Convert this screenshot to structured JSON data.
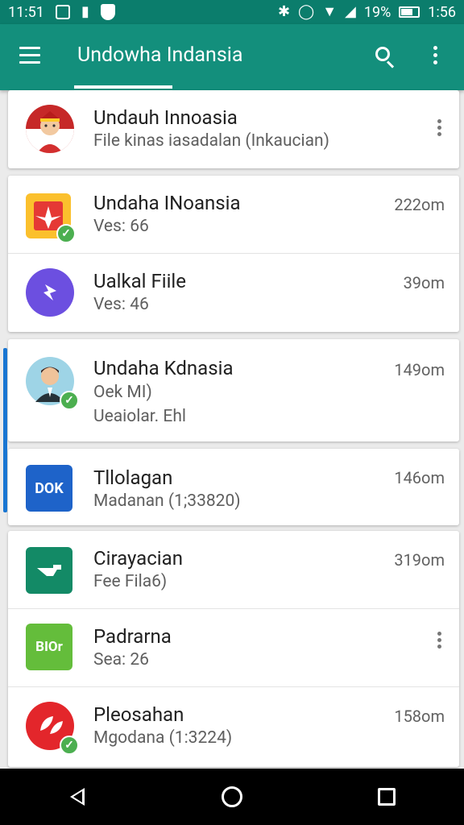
{
  "status_bar": {
    "time_left": "11:51",
    "battery_pct": "19%",
    "time_right": "1:56",
    "icons": [
      "image-icon",
      "phone-icon",
      "shield-icon",
      "bluetooth-icon",
      "alarm-icon",
      "wifi-icon",
      "signal-icon",
      "battery-icon"
    ]
  },
  "app_bar": {
    "title": "Undowha Indansia",
    "icons": [
      "menu-icon",
      "search-icon",
      "more-vert-icon"
    ]
  },
  "colors": {
    "app_bar": "#138f7c",
    "status_bar": "#0b7d6c",
    "badge": "#4caf50",
    "scroll_indicator": "#1976d2"
  },
  "cards": [
    {
      "rows": [
        {
          "title": "Undauh Innoasia",
          "subtitle": "File kinas iasadalan (Inkaucian)",
          "size": "",
          "icon": "avatar-flag-icon",
          "badge": false,
          "has_menu": true
        }
      ]
    },
    {
      "rows": [
        {
          "title": "Undaha INoansia",
          "subtitle": "Ves: 66",
          "size": "222om",
          "icon": "app-red-yellow-icon",
          "badge": true,
          "has_menu": false
        },
        {
          "title": "Ualkal Fiile",
          "subtitle": "Ves: 46",
          "size": "39om",
          "icon": "app-purple-arrow-icon",
          "badge": false,
          "has_menu": false
        }
      ]
    },
    {
      "rows": [
        {
          "title": "Undaha Kdnasia",
          "subtitle": "Oek MI)",
          "subtitle2": "Ueaiolar. Ehl",
          "size": "149om",
          "icon": "avatar-person-icon",
          "badge": true,
          "has_menu": false
        }
      ]
    },
    {
      "rows": [
        {
          "title": "Tllolagan",
          "subtitle": "Madanan (1;33820)",
          "size": "146om",
          "icon": "dok-app-icon",
          "icon_text": "DOK",
          "badge": false,
          "has_menu": false
        }
      ]
    },
    {
      "rows": [
        {
          "title": "Cirayacian",
          "subtitle": "Fee Fila6)",
          "size": "319om",
          "icon": "app-green-arrow-icon",
          "badge": false,
          "has_menu": false
        },
        {
          "title": "Padrarna",
          "subtitle": "Sea: 26",
          "size": "",
          "icon": "app-lime-icon",
          "icon_text": "BIOr",
          "badge": false,
          "has_menu": true
        },
        {
          "title": "Pleosahan",
          "subtitle": "Mgodana (1:3224)",
          "size": "158om",
          "icon": "app-red-leaf-icon",
          "badge": true,
          "has_menu": false
        }
      ]
    }
  ],
  "nav_bar": {
    "icons": [
      "back-icon",
      "home-icon",
      "recents-icon"
    ]
  }
}
